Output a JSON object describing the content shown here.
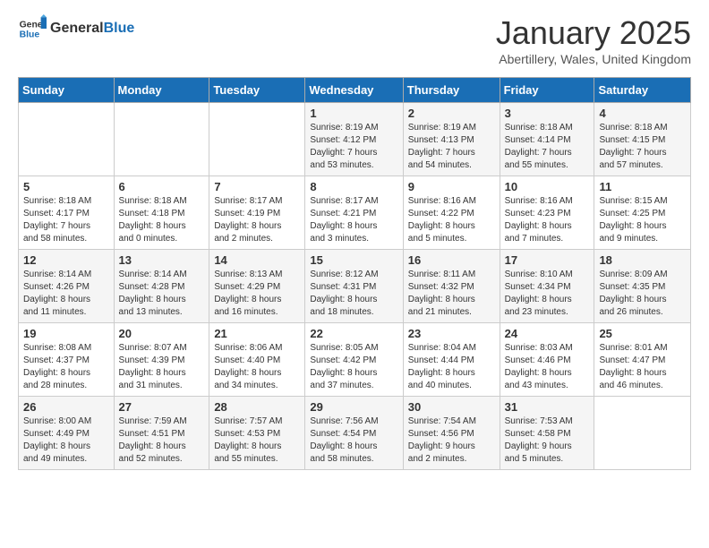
{
  "header": {
    "logo_general": "General",
    "logo_blue": "Blue",
    "month_title": "January 2025",
    "location": "Abertillery, Wales, United Kingdom"
  },
  "weekdays": [
    "Sunday",
    "Monday",
    "Tuesday",
    "Wednesday",
    "Thursday",
    "Friday",
    "Saturday"
  ],
  "weeks": [
    [
      {
        "day": "",
        "info": ""
      },
      {
        "day": "",
        "info": ""
      },
      {
        "day": "",
        "info": ""
      },
      {
        "day": "1",
        "info": "Sunrise: 8:19 AM\nSunset: 4:12 PM\nDaylight: 7 hours and 53 minutes."
      },
      {
        "day": "2",
        "info": "Sunrise: 8:19 AM\nSunset: 4:13 PM\nDaylight: 7 hours and 54 minutes."
      },
      {
        "day": "3",
        "info": "Sunrise: 8:18 AM\nSunset: 4:14 PM\nDaylight: 7 hours and 55 minutes."
      },
      {
        "day": "4",
        "info": "Sunrise: 8:18 AM\nSunset: 4:15 PM\nDaylight: 7 hours and 57 minutes."
      }
    ],
    [
      {
        "day": "5",
        "info": "Sunrise: 8:18 AM\nSunset: 4:17 PM\nDaylight: 7 hours and 58 minutes."
      },
      {
        "day": "6",
        "info": "Sunrise: 8:18 AM\nSunset: 4:18 PM\nDaylight: 8 hours and 0 minutes."
      },
      {
        "day": "7",
        "info": "Sunrise: 8:17 AM\nSunset: 4:19 PM\nDaylight: 8 hours and 2 minutes."
      },
      {
        "day": "8",
        "info": "Sunrise: 8:17 AM\nSunset: 4:21 PM\nDaylight: 8 hours and 3 minutes."
      },
      {
        "day": "9",
        "info": "Sunrise: 8:16 AM\nSunset: 4:22 PM\nDaylight: 8 hours and 5 minutes."
      },
      {
        "day": "10",
        "info": "Sunrise: 8:16 AM\nSunset: 4:23 PM\nDaylight: 8 hours and 7 minutes."
      },
      {
        "day": "11",
        "info": "Sunrise: 8:15 AM\nSunset: 4:25 PM\nDaylight: 8 hours and 9 minutes."
      }
    ],
    [
      {
        "day": "12",
        "info": "Sunrise: 8:14 AM\nSunset: 4:26 PM\nDaylight: 8 hours and 11 minutes."
      },
      {
        "day": "13",
        "info": "Sunrise: 8:14 AM\nSunset: 4:28 PM\nDaylight: 8 hours and 13 minutes."
      },
      {
        "day": "14",
        "info": "Sunrise: 8:13 AM\nSunset: 4:29 PM\nDaylight: 8 hours and 16 minutes."
      },
      {
        "day": "15",
        "info": "Sunrise: 8:12 AM\nSunset: 4:31 PM\nDaylight: 8 hours and 18 minutes."
      },
      {
        "day": "16",
        "info": "Sunrise: 8:11 AM\nSunset: 4:32 PM\nDaylight: 8 hours and 21 minutes."
      },
      {
        "day": "17",
        "info": "Sunrise: 8:10 AM\nSunset: 4:34 PM\nDaylight: 8 hours and 23 minutes."
      },
      {
        "day": "18",
        "info": "Sunrise: 8:09 AM\nSunset: 4:35 PM\nDaylight: 8 hours and 26 minutes."
      }
    ],
    [
      {
        "day": "19",
        "info": "Sunrise: 8:08 AM\nSunset: 4:37 PM\nDaylight: 8 hours and 28 minutes."
      },
      {
        "day": "20",
        "info": "Sunrise: 8:07 AM\nSunset: 4:39 PM\nDaylight: 8 hours and 31 minutes."
      },
      {
        "day": "21",
        "info": "Sunrise: 8:06 AM\nSunset: 4:40 PM\nDaylight: 8 hours and 34 minutes."
      },
      {
        "day": "22",
        "info": "Sunrise: 8:05 AM\nSunset: 4:42 PM\nDaylight: 8 hours and 37 minutes."
      },
      {
        "day": "23",
        "info": "Sunrise: 8:04 AM\nSunset: 4:44 PM\nDaylight: 8 hours and 40 minutes."
      },
      {
        "day": "24",
        "info": "Sunrise: 8:03 AM\nSunset: 4:46 PM\nDaylight: 8 hours and 43 minutes."
      },
      {
        "day": "25",
        "info": "Sunrise: 8:01 AM\nSunset: 4:47 PM\nDaylight: 8 hours and 46 minutes."
      }
    ],
    [
      {
        "day": "26",
        "info": "Sunrise: 8:00 AM\nSunset: 4:49 PM\nDaylight: 8 hours and 49 minutes."
      },
      {
        "day": "27",
        "info": "Sunrise: 7:59 AM\nSunset: 4:51 PM\nDaylight: 8 hours and 52 minutes."
      },
      {
        "day": "28",
        "info": "Sunrise: 7:57 AM\nSunset: 4:53 PM\nDaylight: 8 hours and 55 minutes."
      },
      {
        "day": "29",
        "info": "Sunrise: 7:56 AM\nSunset: 4:54 PM\nDaylight: 8 hours and 58 minutes."
      },
      {
        "day": "30",
        "info": "Sunrise: 7:54 AM\nSunset: 4:56 PM\nDaylight: 9 hours and 2 minutes."
      },
      {
        "day": "31",
        "info": "Sunrise: 7:53 AM\nSunset: 4:58 PM\nDaylight: 9 hours and 5 minutes."
      },
      {
        "day": "",
        "info": ""
      }
    ]
  ]
}
